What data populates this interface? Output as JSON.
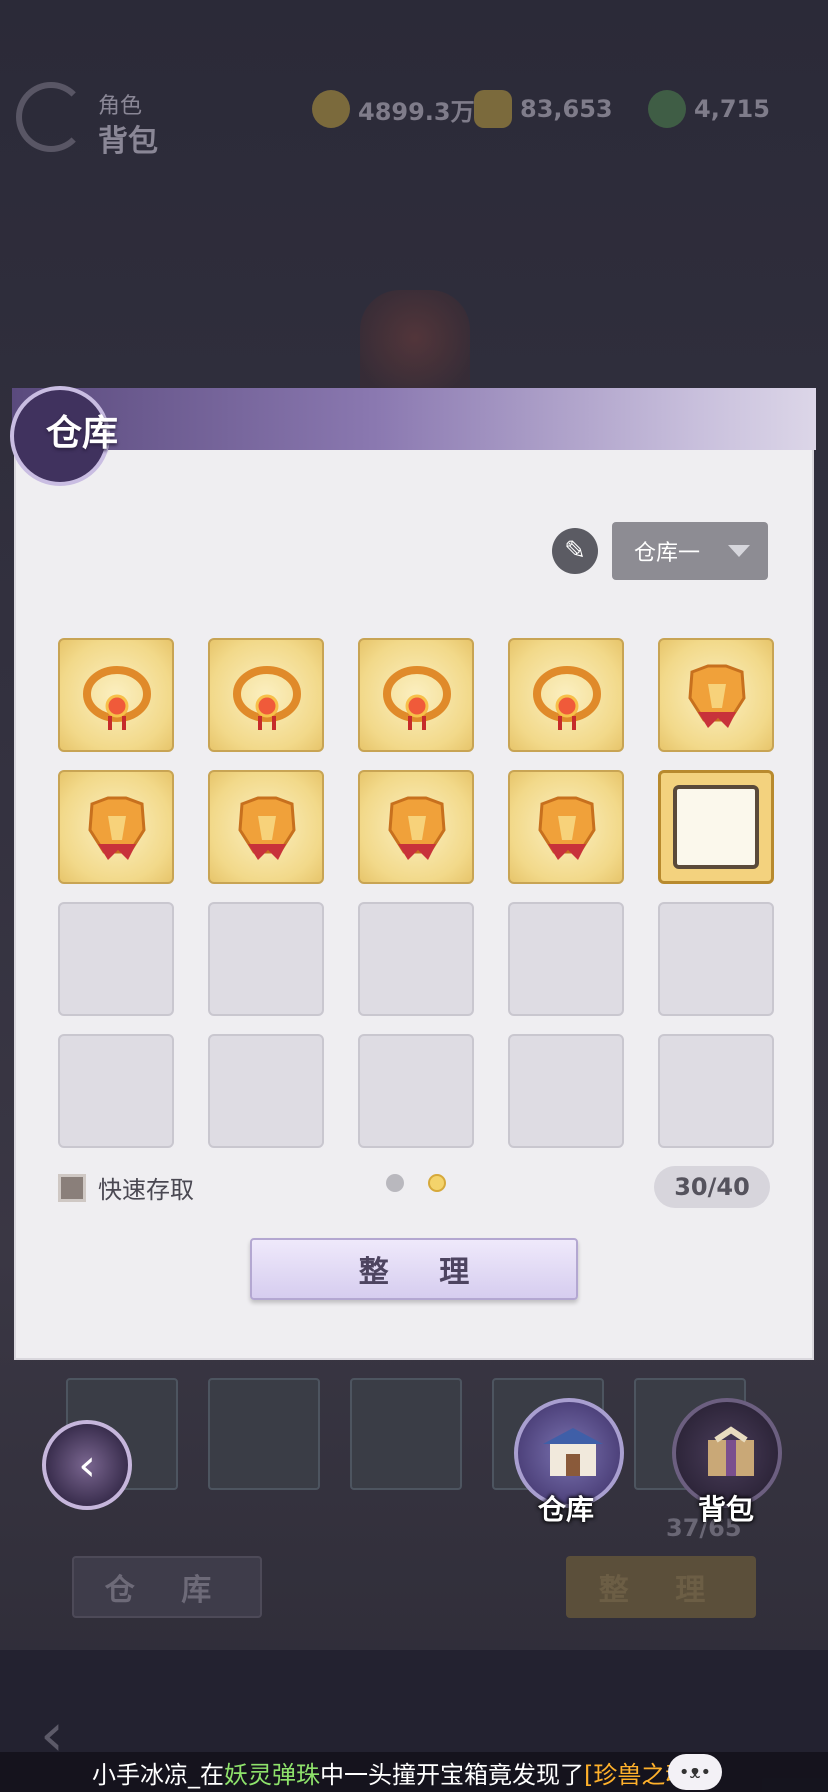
{
  "header": {
    "breadcrumb_sub": "角色",
    "breadcrumb_main": "背包",
    "resources": [
      {
        "icon": "coin-icon",
        "value": "4899.3万"
      },
      {
        "icon": "gold-ingot-icon",
        "value": "83,653"
      },
      {
        "icon": "jade-icon",
        "value": "4,715"
      }
    ]
  },
  "background": {
    "warehouse_label": "仓 库",
    "sort_label": "整 理",
    "capacity": "37/65"
  },
  "dialog": {
    "title": "仓库",
    "selector": {
      "selected": "仓库一"
    },
    "slots": [
      {
        "kind": "item",
        "icon": "necklace-icon"
      },
      {
        "kind": "item",
        "icon": "necklace-icon"
      },
      {
        "kind": "item",
        "icon": "necklace-icon"
      },
      {
        "kind": "item",
        "icon": "necklace-icon"
      },
      {
        "kind": "item",
        "icon": "armor-icon"
      },
      {
        "kind": "item",
        "icon": "armor-icon"
      },
      {
        "kind": "item",
        "icon": "armor-icon"
      },
      {
        "kind": "item",
        "icon": "armor-icon"
      },
      {
        "kind": "item",
        "icon": "armor-icon"
      },
      {
        "kind": "item",
        "icon": "frame-icon"
      },
      {
        "kind": "empty"
      },
      {
        "kind": "empty"
      },
      {
        "kind": "empty"
      },
      {
        "kind": "empty"
      },
      {
        "kind": "empty"
      },
      {
        "kind": "empty"
      },
      {
        "kind": "empty"
      },
      {
        "kind": "empty"
      },
      {
        "kind": "empty"
      },
      {
        "kind": "empty"
      }
    ],
    "quick_access_label": "快速存取",
    "page_total": 2,
    "page_current": 2,
    "capacity": "30/40",
    "sort_button": "整 理"
  },
  "side_tabs": {
    "warehouse_label": "仓库",
    "bag_label": "背包"
  },
  "ticker": {
    "player": "小手冰凉_在",
    "place": "妖灵弹珠",
    "middle": "中一头撞开宝箱竟发现了",
    "reward": "[珍兽之魂]"
  },
  "colors": {
    "accent_purple": "#5a4a7d",
    "item_gold": "#f2d98a",
    "ticker_green": "#8ee26b",
    "ticker_orange": "#ffb12b"
  }
}
